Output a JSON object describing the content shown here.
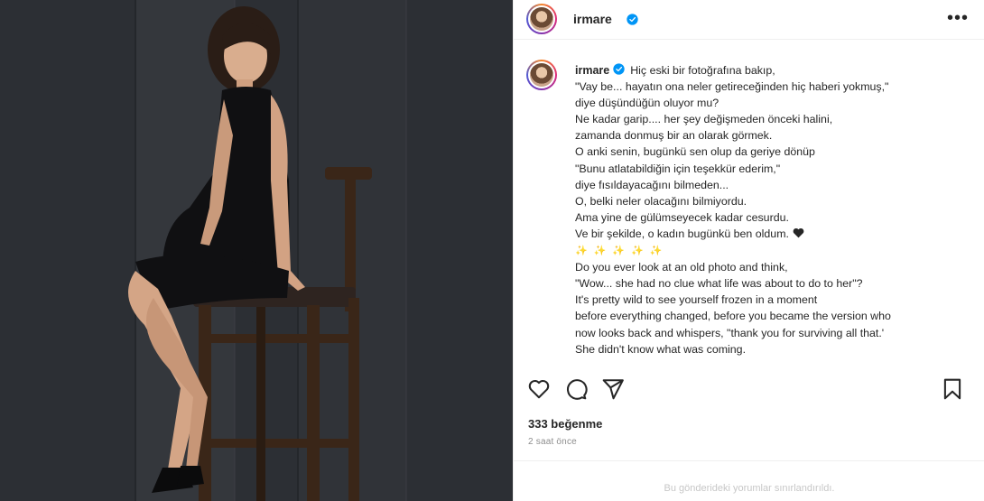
{
  "post": {
    "username": "irmare",
    "more_label": "•••",
    "caption": {
      "username": "irmare",
      "lines": [
        "Hiç eski bir fotoğrafına bakıp,",
        "\"Vay be... hayatın ona neler getireceğinden hiç haberi yokmuş,\"",
        "diye düşündüğün oluyor mu?",
        "Ne kadar garip.... her şey değişmeden önceki halini,",
        "zamanda donmuş bir an olarak görmek.",
        "O anki senin, bugünkü sen olup da geriye dönüp",
        "\"Bunu atlatabildiğin için teşekkür ederim,\"",
        "diye fısıldayacağını bilmeden...",
        "O, belki neler olacağını bilmiyordu.",
        "Ama yine de gülümseyecek kadar cesurdu.",
        "Ve bir şekilde, o kadın bugünkü ben oldum.",
        "Do you ever look at an old photo and think,",
        "\"Wow... she had no clue what life was about to do to her\"?",
        "It's pretty wild to see yourself frozen in a moment",
        "before everything changed, before you became the version who",
        "now looks back and whispers, \"thank you for surviving all that.'",
        "She didn't know what was coming."
      ],
      "emoji_row": [
        "✨",
        "✨",
        "✨",
        "✨",
        "✨"
      ]
    },
    "likes_text": "333 beğenme",
    "time_text": "2 saat önce",
    "comments_disabled_text": "Bu gönderideki yorumlar sınırlandırıldı."
  },
  "icons": {
    "verified": "verified-badge-icon",
    "like": "heart-icon",
    "comment": "comment-icon",
    "share": "send-icon",
    "save": "bookmark-icon"
  },
  "colors": {
    "verified": "#0095f6",
    "text": "#262626",
    "secondary": "#8e8e8e"
  }
}
